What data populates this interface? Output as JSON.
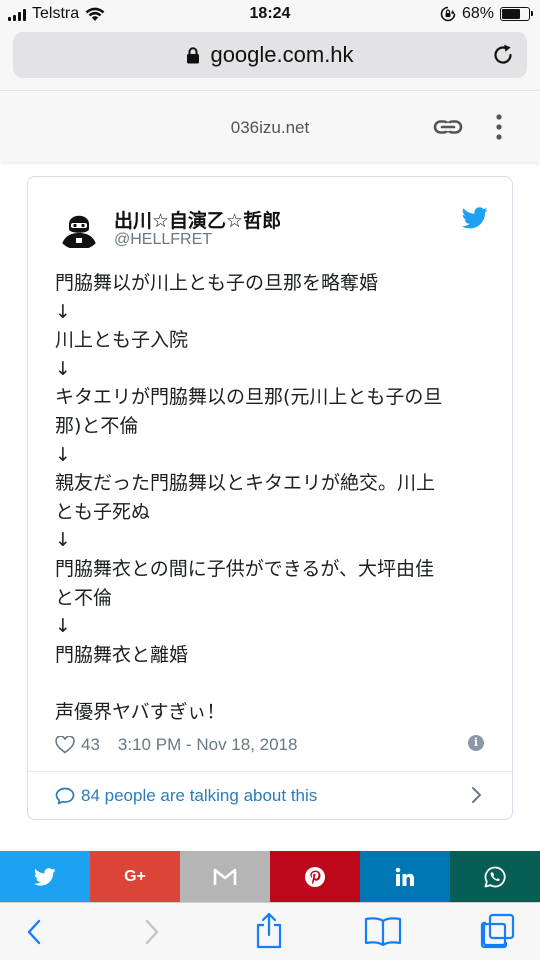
{
  "status_bar": {
    "carrier": "Telstra",
    "time": "18:24",
    "battery_percent": "68%",
    "battery_level": 0.68,
    "icons": [
      "signal-icon",
      "wifi-icon",
      "orientation-lock-icon",
      "battery-icon"
    ]
  },
  "browser": {
    "url": "google.com.hk",
    "icons": [
      "lock-icon",
      "reload-icon"
    ]
  },
  "amp_header": {
    "domain": "036izu.net",
    "icons": [
      "link-icon",
      "more-options-icon"
    ]
  },
  "tweet": {
    "author_name": "出川☆自演乙☆哲郎",
    "author_handle": "@HELLFRET",
    "lines": [
      "門脇舞以が川上とも子の旦那を略奪婚",
      "↓",
      "川上とも子入院",
      "↓",
      "キタエリが門脇舞以の旦那(元川上とも子の旦",
      "那)と不倫",
      "↓",
      "親友だった門脇舞以とキタエリが絶交。川上",
      "とも子死ぬ",
      "↓",
      "門脇舞衣との間に子供ができるが、大坪由佳",
      "と不倫",
      "↓",
      "門脇舞衣と離婚",
      "",
      "声優界ヤバすぎぃ！"
    ],
    "like_count": "43",
    "timestamp": "3:10 PM - Nov 18, 2018",
    "talking": "84 people are talking about this",
    "icons": [
      "twitter-bird-icon",
      "heart-icon",
      "info-icon",
      "speech-bubble-icon",
      "chevron-right-icon"
    ]
  },
  "share_bar": [
    {
      "name": "twitter",
      "icon": "twitter-share-icon",
      "color": "#1da1f2"
    },
    {
      "name": "google-plus",
      "icon": "google-plus-icon",
      "label": "G+",
      "color": "#db4437"
    },
    {
      "name": "email",
      "icon": "email-icon",
      "color": "#b5b5b5"
    },
    {
      "name": "pinterest",
      "icon": "pinterest-icon",
      "color": "#bd081c"
    },
    {
      "name": "linkedin",
      "icon": "linkedin-icon",
      "color": "#0077b5"
    },
    {
      "name": "whatsapp",
      "icon": "whatsapp-icon",
      "color": "#075e54"
    }
  ],
  "toolbar": {
    "icons": [
      "back-icon",
      "forward-icon",
      "share-icon",
      "bookmarks-icon",
      "tabs-icon"
    ]
  }
}
